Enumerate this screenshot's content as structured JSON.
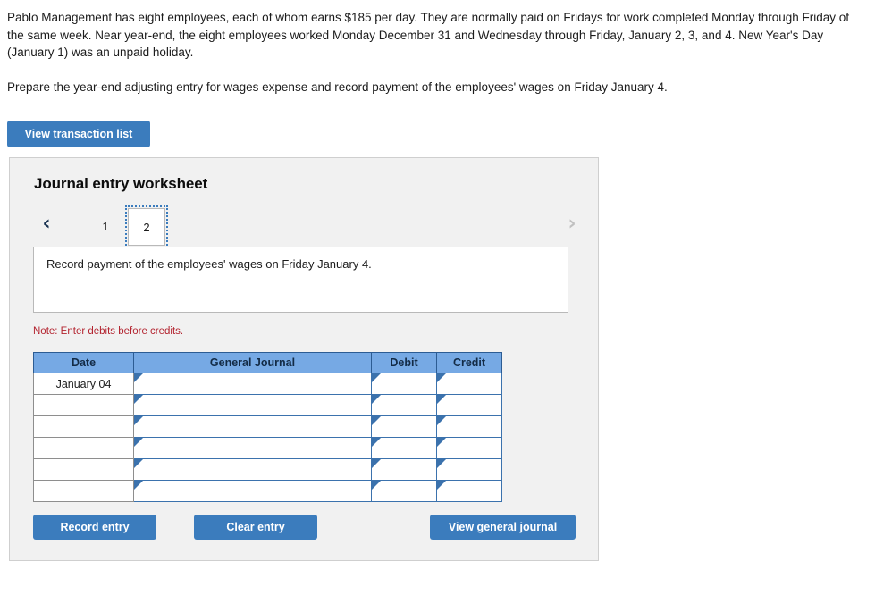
{
  "problem": {
    "paragraph1": "Pablo Management has eight employees, each of whom earns $185 per day. They are normally paid on Fridays for work completed Monday through Friday of the same week. Near year-end, the eight employees worked Monday December 31 and Wednesday through Friday, January 2, 3, and 4. New Year's Day (January 1) was an unpaid holiday.",
    "paragraph2": "Prepare the year-end adjusting entry for wages expense and record payment of the employees' wages on Friday January 4."
  },
  "toolbar": {
    "view_transaction_list_label": "View transaction list"
  },
  "worksheet": {
    "title": "Journal entry worksheet",
    "nav": {
      "prev_icon": "chevron-left-icon",
      "next_icon": "chevron-right-icon",
      "prev_glyph": "‹",
      "next_glyph": "›"
    },
    "tabs": [
      {
        "label": "1",
        "active": false
      },
      {
        "label": "2",
        "active": true
      }
    ],
    "instruction": "Record payment of the employees' wages on Friday January 4.",
    "note": "Note: Enter debits before credits.",
    "table": {
      "headers": [
        "Date",
        "General Journal",
        "Debit",
        "Credit"
      ],
      "rows": [
        {
          "date": "January 04",
          "general_journal": "",
          "debit": "",
          "credit": ""
        },
        {
          "date": "",
          "general_journal": "",
          "debit": "",
          "credit": ""
        },
        {
          "date": "",
          "general_journal": "",
          "debit": "",
          "credit": ""
        },
        {
          "date": "",
          "general_journal": "",
          "debit": "",
          "credit": ""
        },
        {
          "date": "",
          "general_journal": "",
          "debit": "",
          "credit": ""
        },
        {
          "date": "",
          "general_journal": "",
          "debit": "",
          "credit": ""
        }
      ]
    },
    "buttons": {
      "record_entry": "Record entry",
      "clear_entry": "Clear entry",
      "view_general_journal": "View general journal"
    }
  },
  "colors": {
    "button_blue": "#3b7cbd",
    "table_header_blue": "#76a9e4",
    "note_red": "#b3232f",
    "panel_gray": "#f1f1f1",
    "cell_border_blue": "#3b72ad"
  }
}
